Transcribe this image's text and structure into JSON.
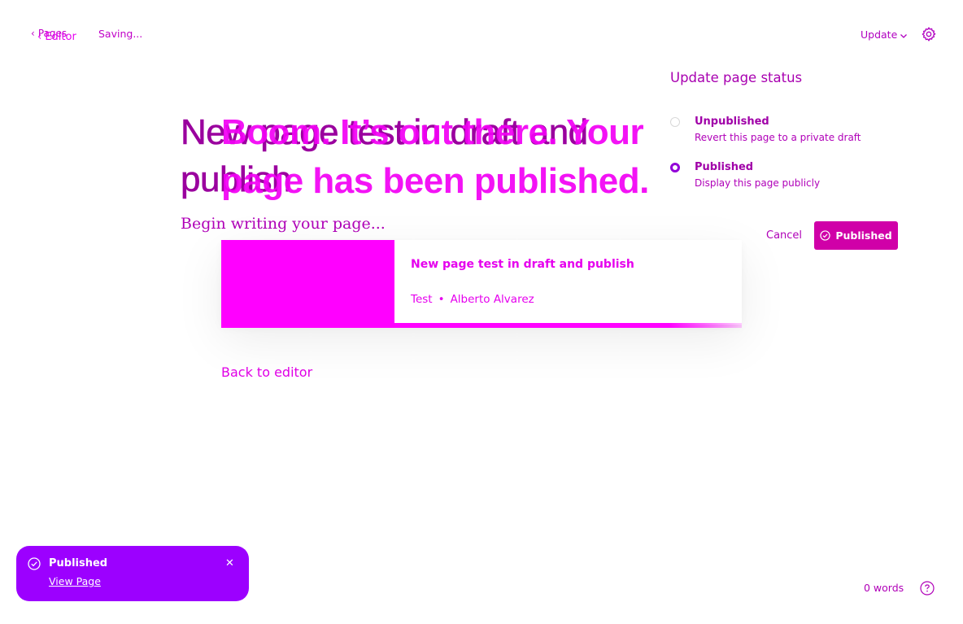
{
  "topbar": {
    "back_label": "Pages",
    "back_editor_label": "Editor",
    "saving_text": "Saving...",
    "update_label": "Update"
  },
  "editor": {
    "title": "New page test in draft and publish",
    "placeholder": "Begin writing your page..."
  },
  "prepublish": {
    "heading": "Boom. It’s out there. Your page has been published.",
    "card": {
      "title": "New page test in draft and publish",
      "site": "Test",
      "author": "Alberto Alvarez"
    },
    "back_to_editor": "Back to editor"
  },
  "status_panel": {
    "title": "Update page status",
    "options": [
      {
        "label": "Unpublished",
        "description": "Revert this page to a private draft",
        "selected": false
      },
      {
        "label": "Published",
        "description": "Display this page publicly",
        "selected": true
      }
    ],
    "cancel_label": "Cancel",
    "confirm_label": "Published"
  },
  "toast": {
    "title": "Published",
    "link_label": "View Page"
  },
  "footer": {
    "word_count": "0 words"
  },
  "icons": {
    "back": "chevron-left-icon",
    "settings": "gear-icon",
    "help": "help-circle-icon",
    "check": "check-circle-icon",
    "close": "close-icon"
  },
  "colors": {
    "accent": "#9c00ff",
    "primary_button": "#d000a8",
    "text": "#a000a8"
  }
}
